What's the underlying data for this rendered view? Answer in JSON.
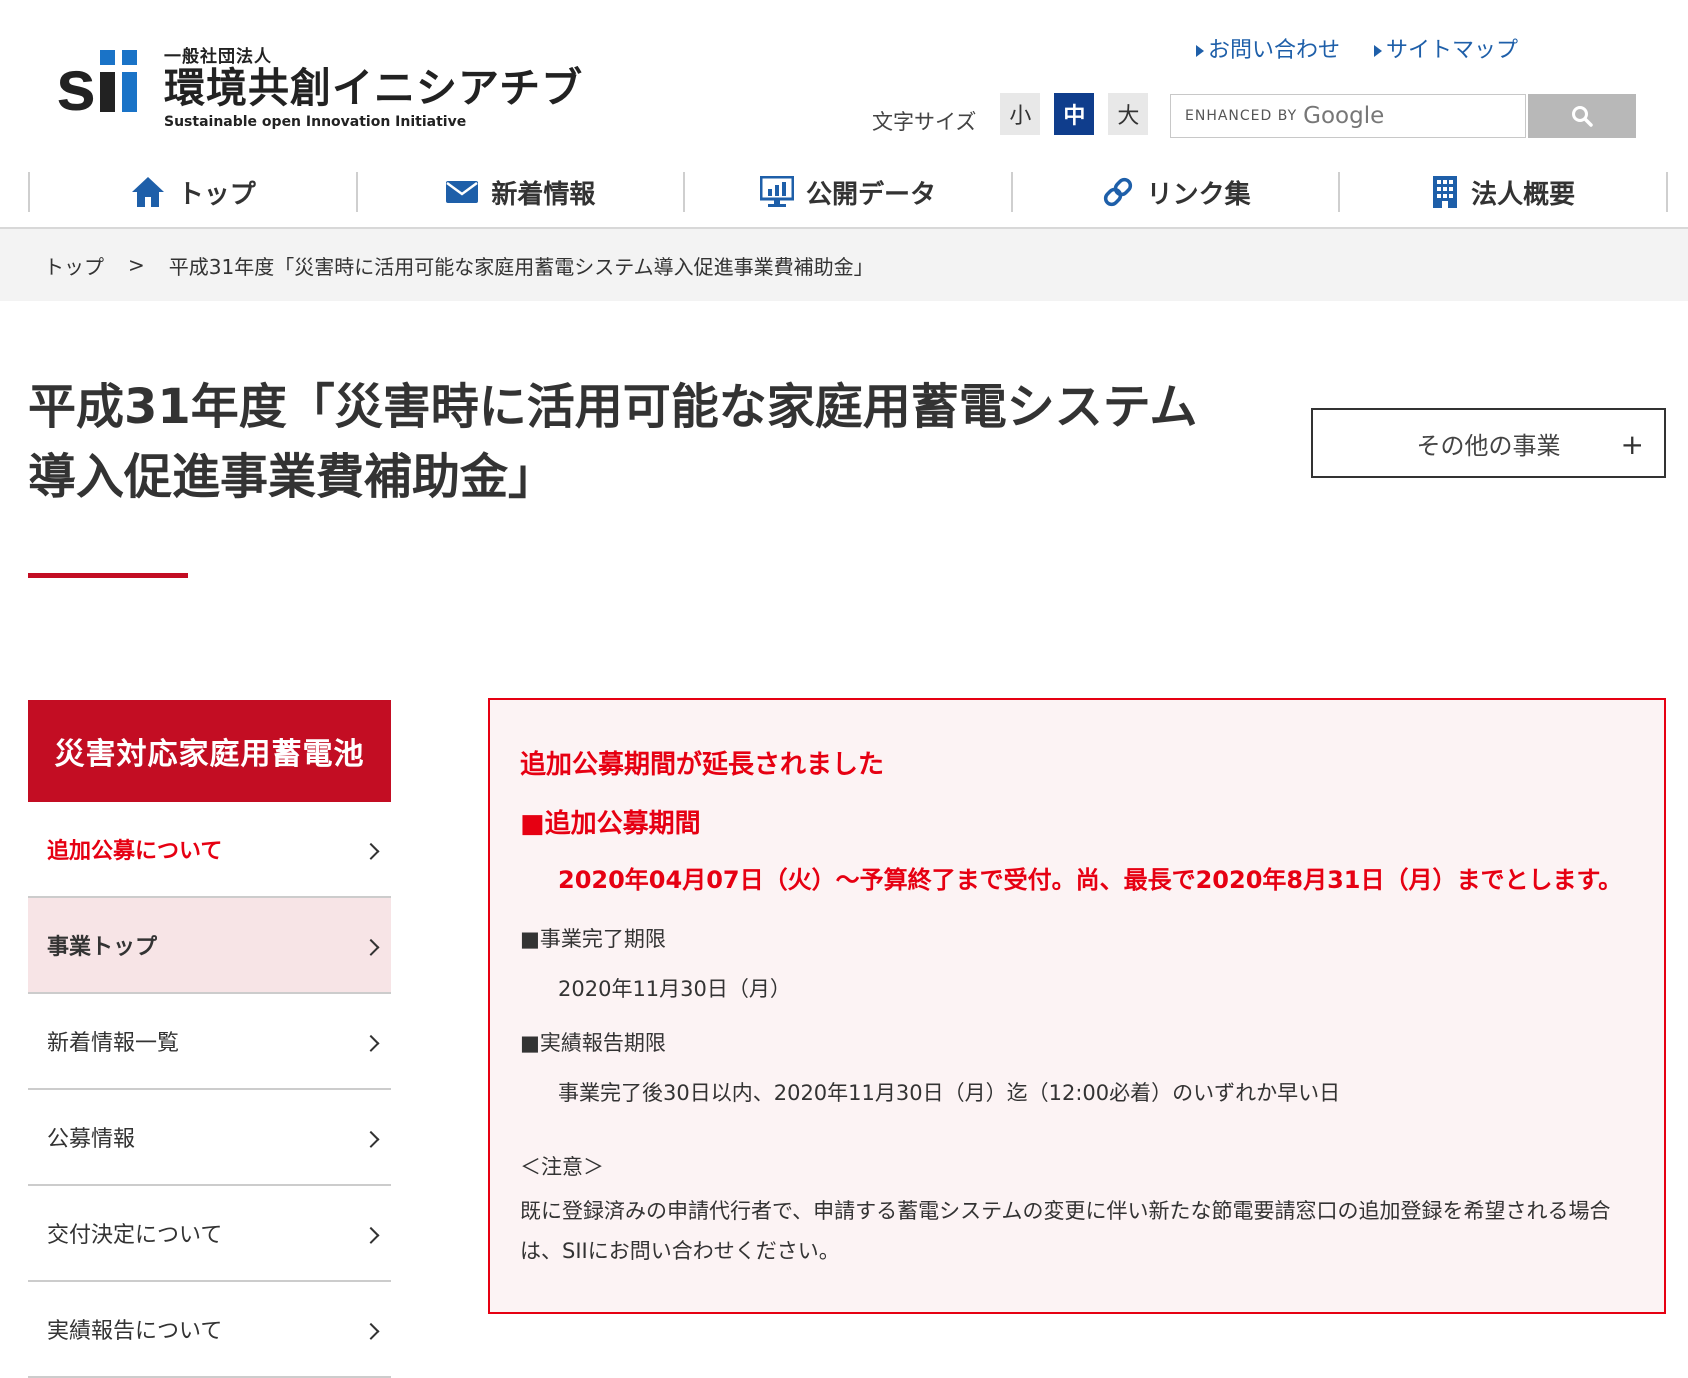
{
  "header": {
    "logo_sub": "一般社団法人",
    "logo_main": "環境共創イニシアチブ",
    "logo_en": "Sustainable open Innovation Initiative",
    "logo_mark": "sii",
    "util_links": [
      "お問い合わせ",
      "サイトマップ"
    ],
    "font_size_label": "文字サイズ",
    "font_sizes": [
      "小",
      "中",
      "大"
    ],
    "font_size_selected": "中",
    "search_placeholder_prefix": "ENHANCED BY",
    "search_placeholder_brand": "Google"
  },
  "nav": [
    {
      "label": "トップ",
      "icon": "home-icon"
    },
    {
      "label": "新着情報",
      "icon": "mail-icon"
    },
    {
      "label": "公開データ",
      "icon": "monitor-chart-icon"
    },
    {
      "label": "リンク集",
      "icon": "link-icon"
    },
    {
      "label": "法人概要",
      "icon": "building-icon"
    }
  ],
  "breadcrumb": {
    "home": "トップ",
    "separator": ">",
    "current": "平成31年度「災害時に活用可能な家庭用蓄電システム導入促進事業費補助金」"
  },
  "page": {
    "title": "平成31年度「災害時に活用可能な家庭用蓄電システム導入促進事業費補助金」",
    "other_button": "その他の事業",
    "other_button_icon": "plus-icon"
  },
  "sidebar": {
    "heading": "災害対応家庭用蓄電池",
    "items": [
      {
        "label": "追加公募について"
      },
      {
        "label": "事業トップ"
      },
      {
        "label": "新着情報一覧"
      },
      {
        "label": "公募情報"
      },
      {
        "label": "交付決定について"
      },
      {
        "label": "実績報告について"
      }
    ]
  },
  "notice": {
    "heading": "追加公募期間が延長されました",
    "period_label": "■追加公募期間",
    "period_value": "2020年04月07日（火）～予算終了まで受付。尚、最長で2020年8月31日（月）までとします。",
    "completion_label": "■事業完了期限",
    "completion_value": "2020年11月30日（月）",
    "report_label": "■実績報告期限",
    "report_value": "事業完了後30日以内、2020年11月30日（月）迄（12:00必着）のいずれか早い日",
    "note_title": "＜注意＞",
    "note_text": "既に登録済みの申請代行者で、申請する蓄電システムの変更に伴い新たな節電要請窓口の追加登録を希望される場合は、SIIにお問い合わせください。"
  },
  "colors": {
    "brand_red": "#c30d23",
    "alert_red": "#e60012",
    "nav_blue": "#1e5fa9",
    "active_fs": "#0f3d8c"
  }
}
